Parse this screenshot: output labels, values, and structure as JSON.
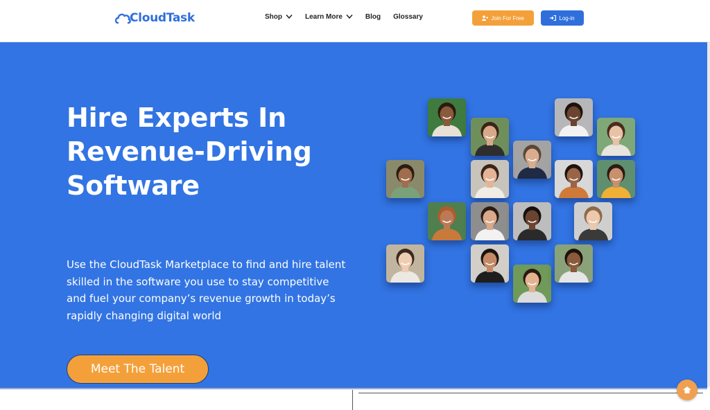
{
  "brand": {
    "name": "CloudTask",
    "color": "#2f6fdc"
  },
  "nav": {
    "items": [
      {
        "label": "Shop",
        "has_dropdown": true
      },
      {
        "label": "Learn More",
        "has_dropdown": true
      },
      {
        "label": "Blog",
        "has_dropdown": false
      },
      {
        "label": "Glossary",
        "has_dropdown": false
      }
    ],
    "join_label": "Join For Free",
    "login_label": "Log-in"
  },
  "hero": {
    "title_lines": [
      "Hire Experts In",
      "Revenue-Driving",
      "Software"
    ],
    "description": "Use the CloudTask Marketplace to find and hire talent skilled in the software you use to stay competitive and fuel your company’s revenue growth in today’s rapidly changing digital world",
    "cta_label": "Meet The Talent",
    "background": "#3274e3",
    "accent": "#f4a03a"
  },
  "talent_photos": [
    {
      "name": "talent-photo",
      "bg": "#3f7a3f",
      "skin": "#8a5a3c",
      "hair": "#2a1a10",
      "shirt": "#e7e1d6"
    },
    {
      "name": "talent-photo",
      "bg": "#6f8f5a",
      "skin": "#d7a98a",
      "hair": "#3a2418",
      "shirt": "#2e2e2e"
    },
    {
      "name": "talent-photo",
      "bg": "#b7b7b9",
      "skin": "#6b4330",
      "hair": "#1c120c",
      "shirt": "#f2f2f2"
    },
    {
      "name": "talent-photo",
      "bg": "#7fa878",
      "skin": "#e9c2a6",
      "hair": "#4a2c1c",
      "shirt": "#e8e4de"
    },
    {
      "name": "talent-photo",
      "bg": "#a3a3a3",
      "skin": "#d9ad8e",
      "hair": "#5b4636",
      "shirt": "#1f2a44"
    },
    {
      "name": "talent-photo",
      "bg": "#8a8a6a",
      "skin": "#a06e4e",
      "hair": "#2a1c12",
      "shirt": "#7aa27a"
    },
    {
      "name": "talent-photo",
      "bg": "#c9c4bb",
      "skin": "#e3b596",
      "hair": "#3b2418",
      "shirt": "#f1ece4"
    },
    {
      "name": "talent-photo",
      "bg": "#d8d8d8",
      "skin": "#9a6448",
      "hair": "#1e130c",
      "shirt": "#d07a3a"
    },
    {
      "name": "talent-photo",
      "bg": "#5f8f6f",
      "skin": "#c9906e",
      "hair": "#2b1b12",
      "shirt": "#f0b035"
    },
    {
      "name": "talent-photo",
      "bg": "#4f7f4f",
      "skin": "#b97a55",
      "hair": "#b45a2a",
      "shirt": "#c97a3a"
    },
    {
      "name": "talent-photo",
      "bg": "#8e8e8e",
      "skin": "#d9a98a",
      "hair": "#2a1a12",
      "shirt": "#f2f2f2"
    },
    {
      "name": "talent-photo",
      "bg": "#bdbdbd",
      "skin": "#6a4430",
      "hair": "#141010",
      "shirt": "#2a2a2a"
    },
    {
      "name": "talent-photo",
      "bg": "#cfcfcf",
      "skin": "#ecc8ac",
      "hair": "#8a6a4a",
      "shirt": "#3a3a3a"
    },
    {
      "name": "talent-photo",
      "bg": "#c1b59f",
      "skin": "#efcdb2",
      "hair": "#3a2a1e",
      "shirt": "#ece8e2"
    },
    {
      "name": "talent-photo",
      "bg": "#d3cfc8",
      "skin": "#c48a66",
      "hair": "#1c1410",
      "shirt": "#1e1e1e"
    },
    {
      "name": "talent-photo",
      "bg": "#6f9a5a",
      "skin": "#e3b390",
      "hair": "#2a1a12",
      "shirt": "#dcdcdc"
    },
    {
      "name": "talent-photo",
      "bg": "#8aa27a",
      "skin": "#8a5a3c",
      "hair": "#1c120c",
      "shirt": "#e6e6e6"
    }
  ]
}
